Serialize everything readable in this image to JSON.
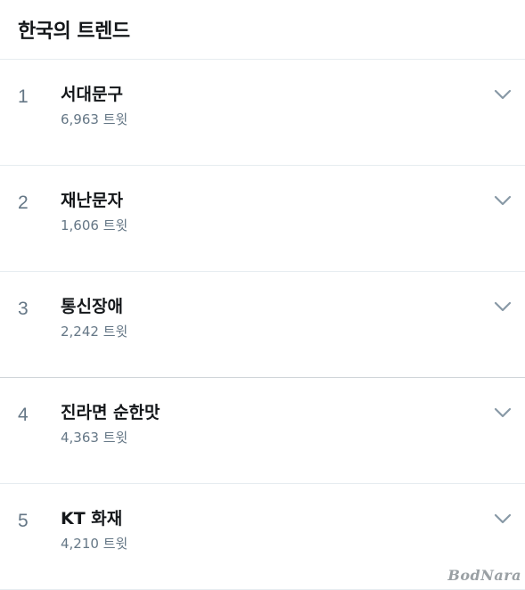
{
  "header": {
    "title": "한국의 트렌드"
  },
  "trends": [
    {
      "rank": "1",
      "topic": "서대문구",
      "count": "6,963 트윗"
    },
    {
      "rank": "2",
      "topic": "재난문자",
      "count": "1,606 트윗"
    },
    {
      "rank": "3",
      "topic": "통신장애",
      "count": "2,242 트윗"
    },
    {
      "rank": "4",
      "topic": "진라면 순한맛",
      "count": "4,363 트윗"
    },
    {
      "rank": "5",
      "topic": "KT 화재",
      "count": "4,210 트윗"
    }
  ],
  "icons": {
    "chevron": "chevron-down-icon"
  },
  "colors": {
    "text_primary": "#14171a",
    "text_secondary": "#657786",
    "divider": "#e6ecf0",
    "chevron": "#8899a6"
  },
  "watermark": "BodNara"
}
